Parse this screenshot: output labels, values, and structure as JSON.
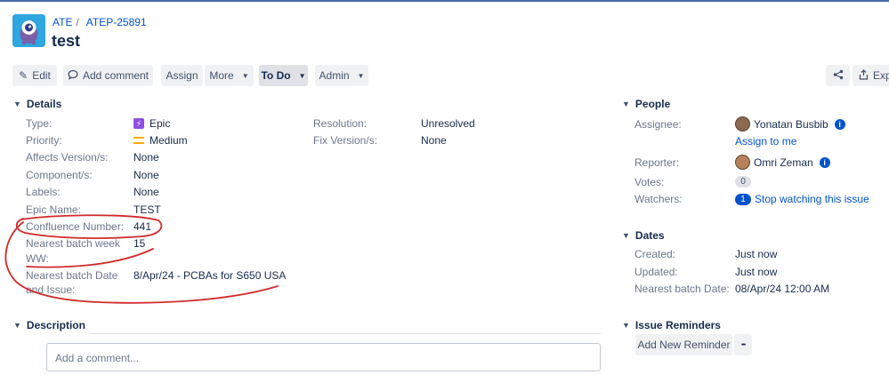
{
  "header": {
    "project": "ATE",
    "issue_key": "ATEP-25891",
    "title": "test"
  },
  "toolbar": {
    "edit": "Edit",
    "add_comment": "Add comment",
    "assign": "Assign",
    "more": "More",
    "status": "To Do",
    "admin": "Admin",
    "export": "Exp"
  },
  "details": {
    "heading": "Details",
    "type_label": "Type:",
    "type_value": "Epic",
    "priority_label": "Priority:",
    "priority_value": "Medium",
    "affects_label": "Affects Version/s:",
    "affects_value": "None",
    "component_label": "Component/s:",
    "component_value": "None",
    "labels_label": "Labels:",
    "labels_value": "None",
    "epic_name_label": "Epic Name:",
    "epic_name_value": "TEST",
    "confluence_label": "Confluence Number:",
    "confluence_value": "441",
    "batch_week_label_1": "Nearest batch week",
    "batch_week_label_2": "WW:",
    "batch_week_value": "15",
    "batch_date_label_1": "Nearest batch Date",
    "batch_date_label_2": "and Issue:",
    "batch_date_value": "8/Apr/24 - PCBAs for S650 USA",
    "resolution_label": "Resolution:",
    "resolution_value": "Unresolved",
    "fix_label": "Fix Version/s:",
    "fix_value": "None"
  },
  "description": {
    "heading": "Description",
    "comment_placeholder": "Add a comment..."
  },
  "people": {
    "heading": "People",
    "assignee_label": "Assignee:",
    "assignee_name": "Yonatan Busbib",
    "assign_to_me": "Assign to me",
    "reporter_label": "Reporter:",
    "reporter_name": "Omri Zeman",
    "votes_label": "Votes:",
    "votes_count": "0",
    "watchers_label": "Watchers:",
    "watchers_count": "1",
    "watch_action": "Stop watching this issue"
  },
  "dates": {
    "heading": "Dates",
    "created_label": "Created:",
    "created_value": "Just now",
    "updated_label": "Updated:",
    "updated_value": "Just now",
    "batch_date_label": "Nearest batch Date:",
    "batch_date_value": "08/Apr/24 12:00 AM"
  },
  "reminders": {
    "heading": "Issue Reminders",
    "add_button": "Add New Reminder",
    "more_button": "•••"
  },
  "colors": {
    "link": "#0052cc",
    "label": "#6b778c",
    "annotation": "#d22a2a"
  }
}
